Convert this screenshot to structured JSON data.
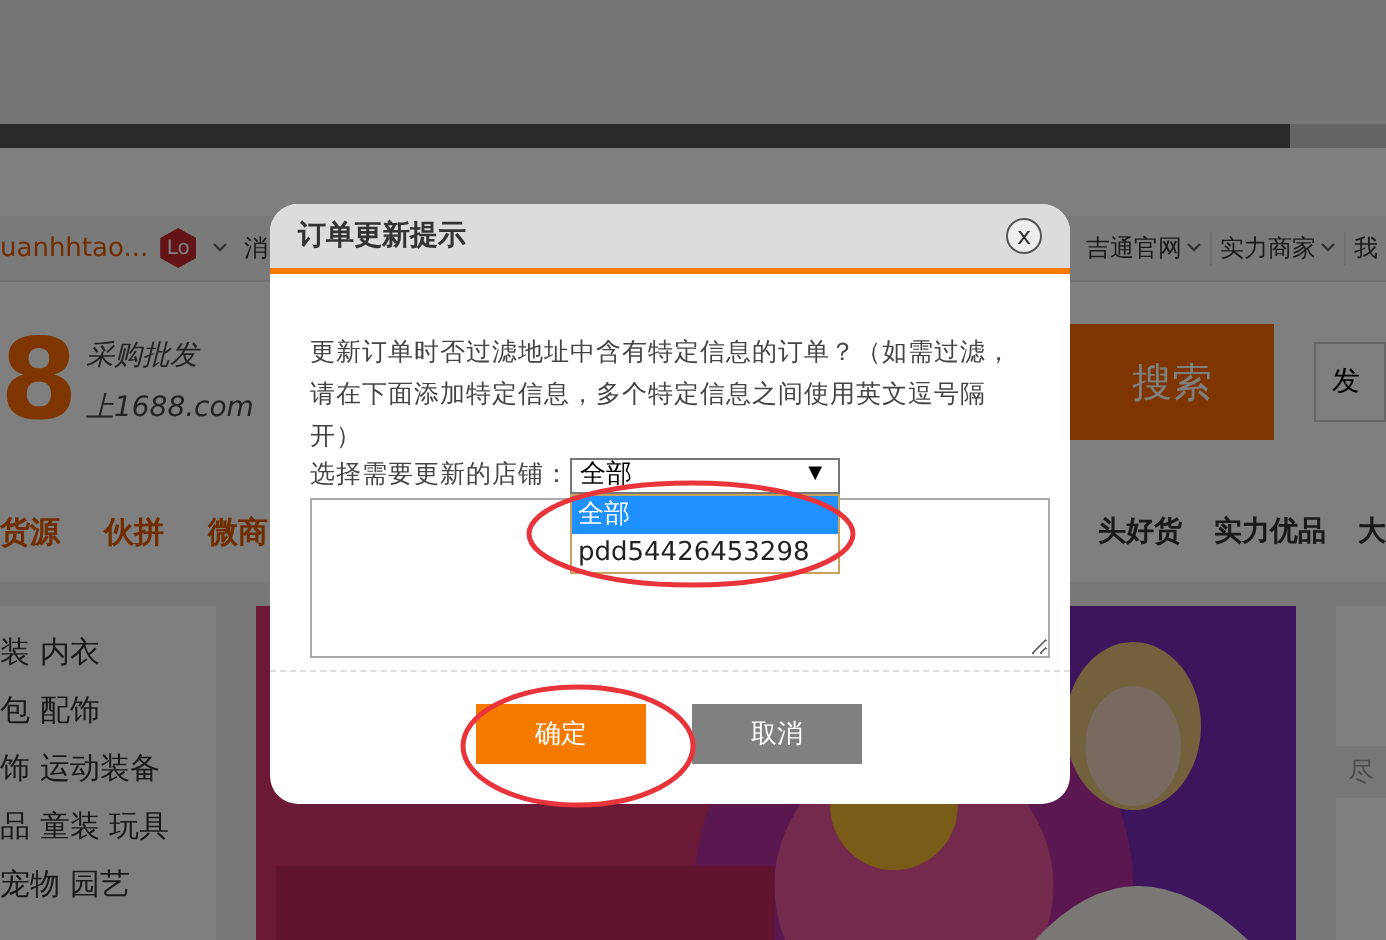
{
  "background": {
    "account": "uanhhtao...",
    "badge": "Lo",
    "top_links": [
      {
        "label": "消",
        "chevron": false
      },
      {
        "label": "吉通官网",
        "chevron": true
      },
      {
        "label": "实力商家",
        "chevron": true
      },
      {
        "label": "我",
        "chevron": false
      }
    ],
    "logo_digit": "8",
    "logo_tagline": "采购批发",
    "logo_domain": "上1688.com",
    "search_button": "搜索",
    "publish_button": "发",
    "nav_left": [
      "货源",
      "伙拼",
      "微商"
    ],
    "nav_right": [
      "头好货",
      "实力优品",
      "大"
    ],
    "categories": [
      "装 内衣",
      "包 配饰",
      "饰 运动装备",
      "品 童装 玩具",
      "宠物 园艺"
    ],
    "side_box": "尽"
  },
  "dialog": {
    "title": "订单更新提示",
    "close": "x",
    "message": "更新订单时否过滤地址中含有特定信息的订单？（如需过滤，请在下面添加特定信息，多个特定信息之间使用英文逗号隔开）",
    "store_label": "选择需要更新的店铺：",
    "store_select": {
      "value": "全部",
      "arrow": "▼",
      "expanded": true,
      "options": [
        {
          "label": "全部",
          "selected": true
        },
        {
          "label": "pdd54426453298",
          "selected": false
        }
      ]
    },
    "buttons": [
      {
        "label": "确定",
        "kind": "primary"
      },
      {
        "label": "取消",
        "kind": "secondary"
      }
    ]
  },
  "annotations": [
    {
      "kind": "ellipse"
    },
    {
      "kind": "ellipse"
    }
  ]
}
